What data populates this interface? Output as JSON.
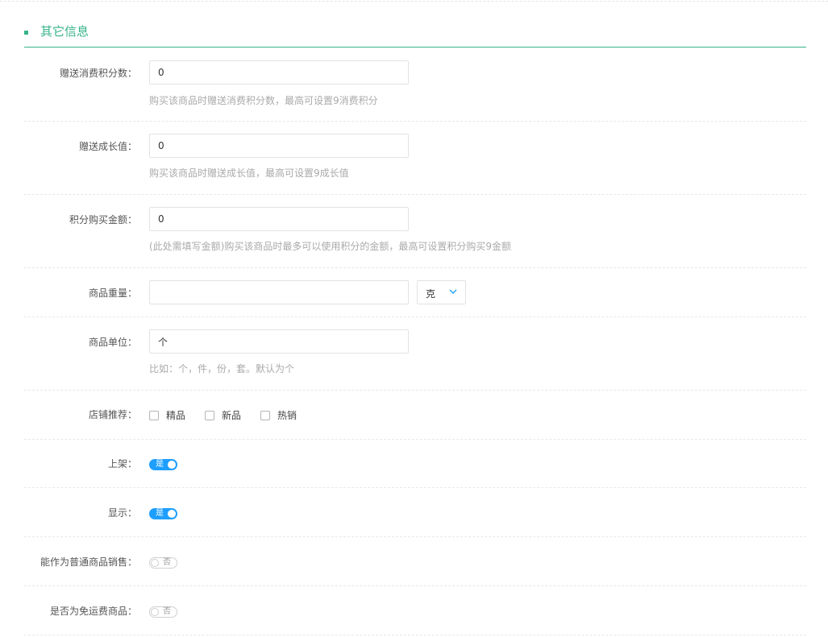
{
  "section": {
    "title": "其它信息"
  },
  "points_gift": {
    "label": "赠送消费积分数：",
    "value": "0",
    "hint": "购买该商品时赠送消费积分数，最高可设置9消费积分"
  },
  "growth_gift": {
    "label": "赠送成长值：",
    "value": "0",
    "hint": "购买该商品时赠送成长值，最高可设置9成长值"
  },
  "points_purchase": {
    "label": "积分购买金额：",
    "value": "0",
    "hint": "(此处需填写金额)购买该商品时最多可以使用积分的金额，最高可设置积分购买9金额"
  },
  "weight": {
    "label": "商品重量：",
    "value": "",
    "unit": "克"
  },
  "unit": {
    "label": "商品单位：",
    "value": "个",
    "hint": "比如：个，件，份，套。默认为个"
  },
  "recommend": {
    "label": "店铺推荐：",
    "options": [
      "精品",
      "新品",
      "热销"
    ]
  },
  "on_shelf": {
    "label": "上架：",
    "state": "是"
  },
  "display": {
    "label": "显示：",
    "state": "是"
  },
  "normal_sale": {
    "label": "能作为普通商品销售：",
    "state": "否"
  },
  "free_shipping": {
    "label": "是否为免运费商品：",
    "state": "否"
  },
  "colors": {
    "accent": "#36b389",
    "switch_on": "#1e9fff"
  }
}
